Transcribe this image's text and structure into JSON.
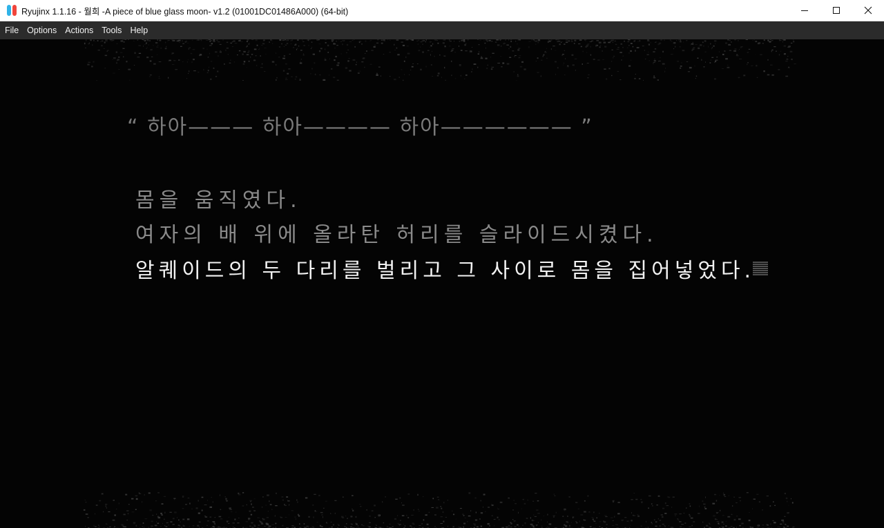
{
  "window": {
    "title": "Ryujinx 1.1.16 - 월희 -A piece of blue glass moon- v1.2 (01001DC01486A000) (64-bit)",
    "controls": [
      "minimize-icon",
      "maximize-icon",
      "close-icon"
    ]
  },
  "menu": {
    "items": [
      {
        "label": "File"
      },
      {
        "label": "Options"
      },
      {
        "label": "Actions"
      },
      {
        "label": "Tools"
      },
      {
        "label": "Help"
      }
    ]
  },
  "game": {
    "quote_line": "“ 하아——— 하아———— 하아—————— ”",
    "lines": [
      "몸을 움직였다.",
      "여자의 배 위에 올라탄 허리를 슬라이드시켰다.",
      "알퀘이드의 두 다리를 벌리고 그 사이로 몸을 집어넣었다."
    ],
    "cursor_icon": "text-advance-icon"
  },
  "colors": {
    "titlebar_bg": "#ffffff",
    "menubar_bg": "#2b2b2b",
    "game_bg": "#040404",
    "dim_text": "#8a8a8a",
    "active_text": "#f2f2f2",
    "icon_left": "#2fb3e8",
    "icon_right": "#f0453c"
  }
}
